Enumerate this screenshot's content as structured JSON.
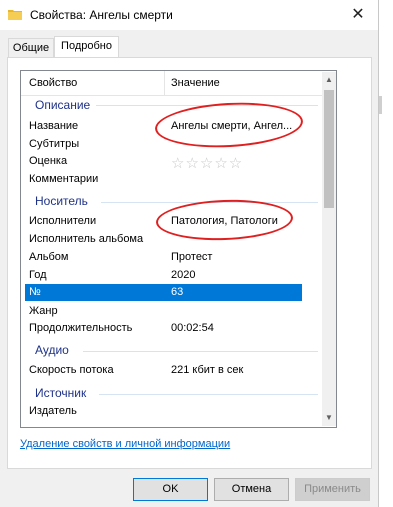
{
  "window": {
    "title": "Свойства: Ангелы смерти",
    "close_glyph": "✕"
  },
  "tabs": [
    {
      "label": "Общие",
      "active": false
    },
    {
      "label": "Подробно",
      "active": true
    }
  ],
  "columns": {
    "property": "Свойство",
    "value": "Значение"
  },
  "groups": {
    "description": "Описание",
    "media": "Носитель",
    "audio": "Аудио",
    "origin": "Источник"
  },
  "rows": [
    {
      "name": "Название",
      "value": "Ангелы смерти, Ангел..."
    },
    {
      "name": "Субтитры",
      "value": ""
    },
    {
      "name": "Оценка",
      "value": "",
      "stars": 0,
      "stars_max": 5
    },
    {
      "name": "Комментарии",
      "value": ""
    },
    {
      "name": "Исполнители",
      "value": "Патология, Патологи"
    },
    {
      "name": "Исполнитель альбома",
      "value": ""
    },
    {
      "name": "Альбом",
      "value": "Протест"
    },
    {
      "name": "Год",
      "value": "2020"
    },
    {
      "name": "№",
      "value": "63",
      "selected": true
    },
    {
      "name": "Жанр",
      "value": ""
    },
    {
      "name": "Продолжительность",
      "value": "00:02:54"
    },
    {
      "name": "Скорость потока",
      "value": "221 кбит в сек"
    },
    {
      "name": "Издатель",
      "value": ""
    }
  ],
  "stars_glyphs": "☆☆☆☆☆",
  "remove_link": "Удаление свойств и личной информации",
  "buttons": {
    "ok": "OK",
    "cancel": "Отмена",
    "apply": "Применить"
  },
  "scroll_up": "▲",
  "scroll_down": "▼",
  "colors": {
    "selection": "#0078d7",
    "group_text": "#1e3287",
    "link": "#0066cc",
    "annotation": "#e02020"
  }
}
